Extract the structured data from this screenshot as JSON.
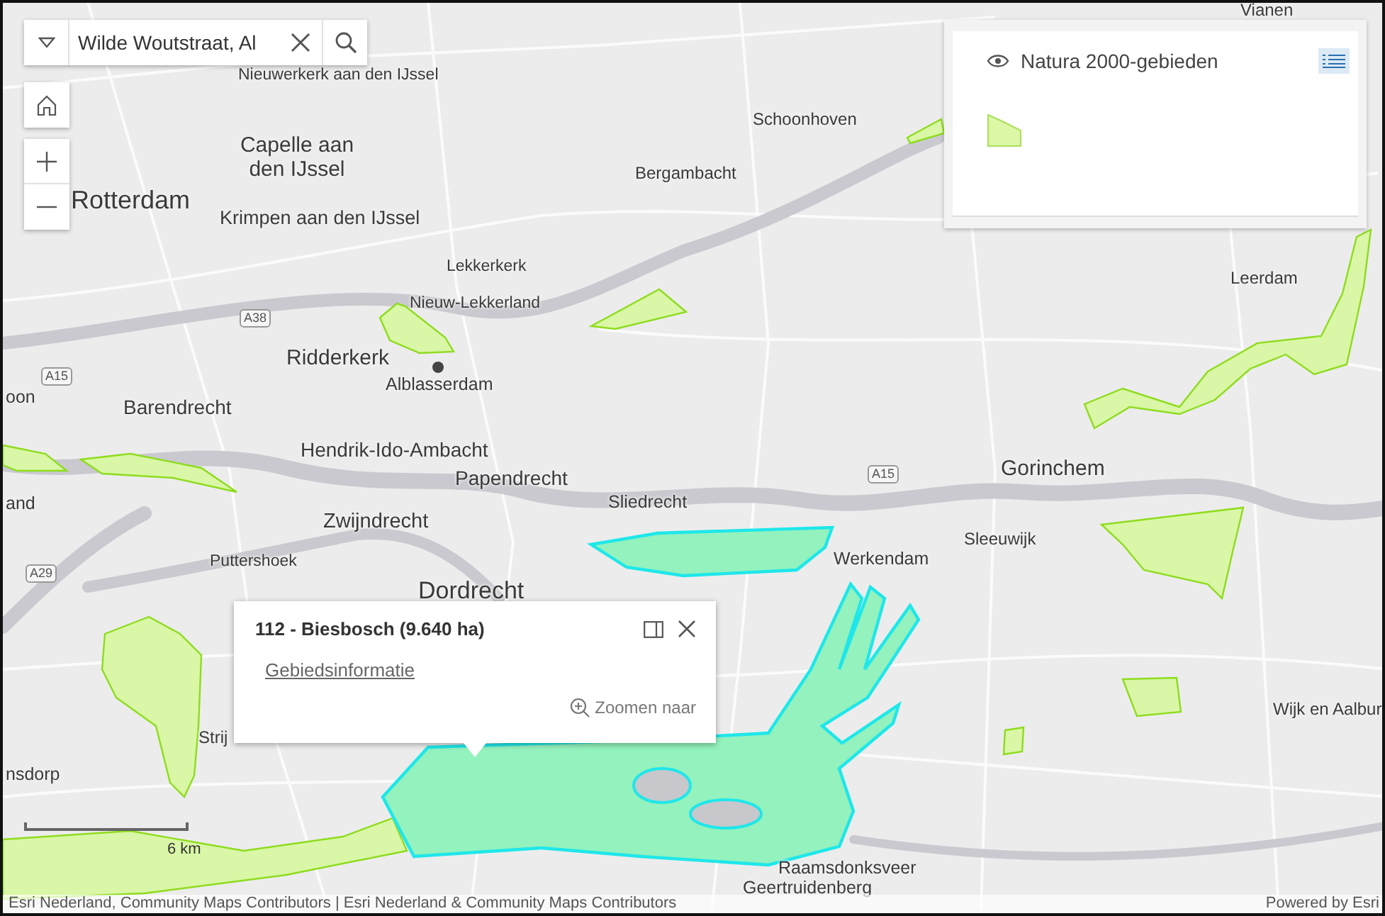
{
  "search": {
    "value": "Wilde Woutstraat, Al"
  },
  "legend": {
    "layer_title": "Natura 2000-gebieden"
  },
  "map_labels": [
    {
      "kind": "place",
      "text": "Vianen"
    },
    {
      "kind": "place",
      "text": "Nieuwerkerk aan den IJssel"
    },
    {
      "kind": "place",
      "text": "Schoonhoven"
    },
    {
      "kind": "place",
      "text": "Capelle aan den IJssel"
    },
    {
      "kind": "place",
      "text": "Bergambacht"
    },
    {
      "kind": "place",
      "text": "Rotterdam"
    },
    {
      "kind": "place",
      "text": "Krimpen aan den IJssel"
    },
    {
      "kind": "place",
      "text": "Lekkerkerk"
    },
    {
      "kind": "place",
      "text": "Leerdam"
    },
    {
      "kind": "place",
      "text": "Nieuw-Lekkerland"
    },
    {
      "kind": "road",
      "text": "A38"
    },
    {
      "kind": "place",
      "text": "Ridderkerk"
    },
    {
      "kind": "place",
      "text": "Alblasserdam"
    },
    {
      "kind": "road",
      "text": "A15"
    },
    {
      "kind": "place",
      "text": "oon"
    },
    {
      "kind": "place",
      "text": "Barendrecht"
    },
    {
      "kind": "place",
      "text": "Hendrik-Ido-Ambacht"
    },
    {
      "kind": "place",
      "text": "Papendrecht"
    },
    {
      "kind": "place",
      "text": "Gorinchem"
    },
    {
      "kind": "road",
      "text": "A15"
    },
    {
      "kind": "place",
      "text": "and"
    },
    {
      "kind": "place",
      "text": "Sliedrecht"
    },
    {
      "kind": "place",
      "text": "Zwijndrecht"
    },
    {
      "kind": "place",
      "text": "Sleeuwijk"
    },
    {
      "kind": "place",
      "text": "Werkendam"
    },
    {
      "kind": "place",
      "text": "Puttershoek"
    },
    {
      "kind": "road",
      "text": "A29"
    },
    {
      "kind": "place",
      "text": "Dordrecht"
    },
    {
      "kind": "place",
      "text": "Wijk en Aalbur"
    },
    {
      "kind": "place",
      "text": "Strij"
    },
    {
      "kind": "place",
      "text": "nsdorp"
    },
    {
      "kind": "place",
      "text": "Raamsdonksveer"
    },
    {
      "kind": "place",
      "text": "Geertruidenberg"
    }
  ],
  "popup": {
    "title": "112 - Biesbosch (9.640 ha)",
    "link": "Gebiedsinformatie",
    "zoom_action": "Zoomen naar"
  },
  "scale_bar": {
    "label": "6 km"
  },
  "attribution": {
    "text": "Esri Nederland, Community Maps Contributors | Esri Nederland & Community Maps Contributors",
    "powered_by": "Powered by Esri"
  }
}
